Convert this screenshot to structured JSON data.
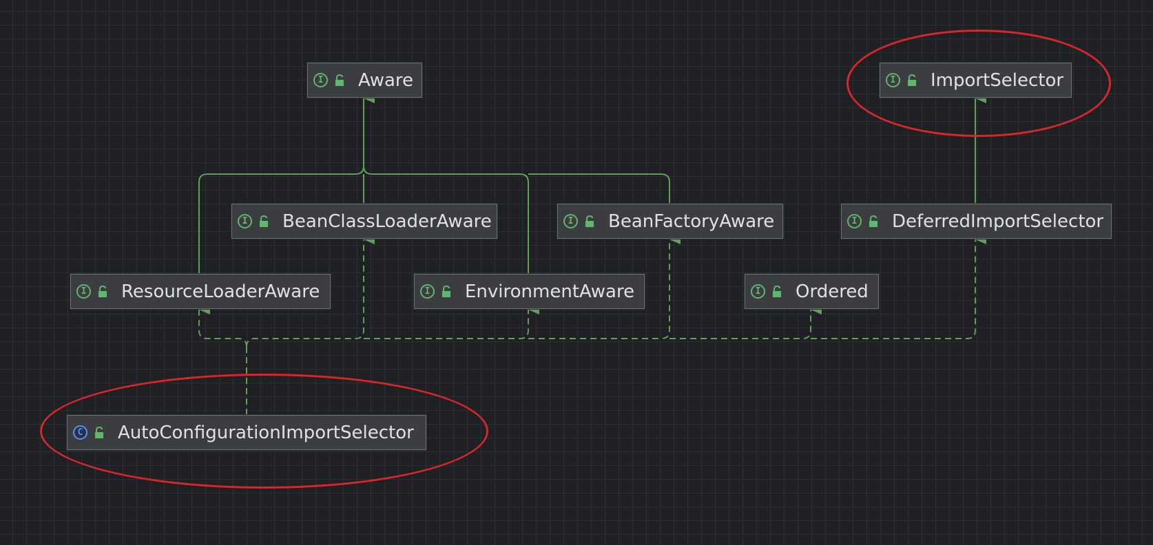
{
  "nodes": [
    {
      "id": "aware",
      "label": "Aware",
      "kind": "interface",
      "kind_glyph": "I",
      "icon": "interface-icon"
    },
    {
      "id": "import-selector",
      "label": "ImportSelector",
      "kind": "interface",
      "kind_glyph": "I",
      "icon": "interface-icon"
    },
    {
      "id": "bean-class-loader-aware",
      "label": "BeanClassLoaderAware",
      "kind": "interface",
      "kind_glyph": "I",
      "icon": "interface-icon"
    },
    {
      "id": "bean-factory-aware",
      "label": "BeanFactoryAware",
      "kind": "interface",
      "kind_glyph": "I",
      "icon": "interface-icon"
    },
    {
      "id": "deferred-import-selector",
      "label": "DeferredImportSelector",
      "kind": "interface",
      "kind_glyph": "I",
      "icon": "interface-icon"
    },
    {
      "id": "resource-loader-aware",
      "label": "ResourceLoaderAware",
      "kind": "interface",
      "kind_glyph": "I",
      "icon": "interface-icon"
    },
    {
      "id": "environment-aware",
      "label": "EnvironmentAware",
      "kind": "interface",
      "kind_glyph": "I",
      "icon": "interface-icon"
    },
    {
      "id": "ordered",
      "label": "Ordered",
      "kind": "interface",
      "kind_glyph": "I",
      "icon": "interface-icon"
    },
    {
      "id": "auto-configuration-import-selector",
      "label": "AutoConfigurationImportSelector",
      "kind": "class",
      "kind_glyph": "C",
      "icon": "class-icon"
    }
  ],
  "edges": [
    {
      "from": "resource-loader-aware",
      "to": "aware",
      "type": "extends"
    },
    {
      "from": "bean-class-loader-aware",
      "to": "aware",
      "type": "extends"
    },
    {
      "from": "environment-aware",
      "to": "aware",
      "type": "extends"
    },
    {
      "from": "bean-factory-aware",
      "to": "aware",
      "type": "extends"
    },
    {
      "from": "deferred-import-selector",
      "to": "import-selector",
      "type": "extends"
    },
    {
      "from": "auto-configuration-import-selector",
      "to": "resource-loader-aware",
      "type": "implements"
    },
    {
      "from": "auto-configuration-import-selector",
      "to": "bean-class-loader-aware",
      "type": "implements"
    },
    {
      "from": "auto-configuration-import-selector",
      "to": "environment-aware",
      "type": "implements"
    },
    {
      "from": "auto-configuration-import-selector",
      "to": "bean-factory-aware",
      "type": "implements"
    },
    {
      "from": "auto-configuration-import-selector",
      "to": "ordered",
      "type": "implements"
    },
    {
      "from": "auto-configuration-import-selector",
      "to": "deferred-import-selector",
      "type": "implements"
    }
  ],
  "highlighted": [
    "import-selector",
    "auto-configuration-import-selector"
  ],
  "colors": {
    "background": "#1f2023",
    "grid": "#2c2e33",
    "node_fill": "#3b3d40",
    "node_border": "#6c6f75",
    "text": "#dfe1e5",
    "edge": "#62a05a",
    "interface_icon": "#5fb86b",
    "class_icon": "#5b8ef0",
    "highlight": "#d8262a"
  }
}
